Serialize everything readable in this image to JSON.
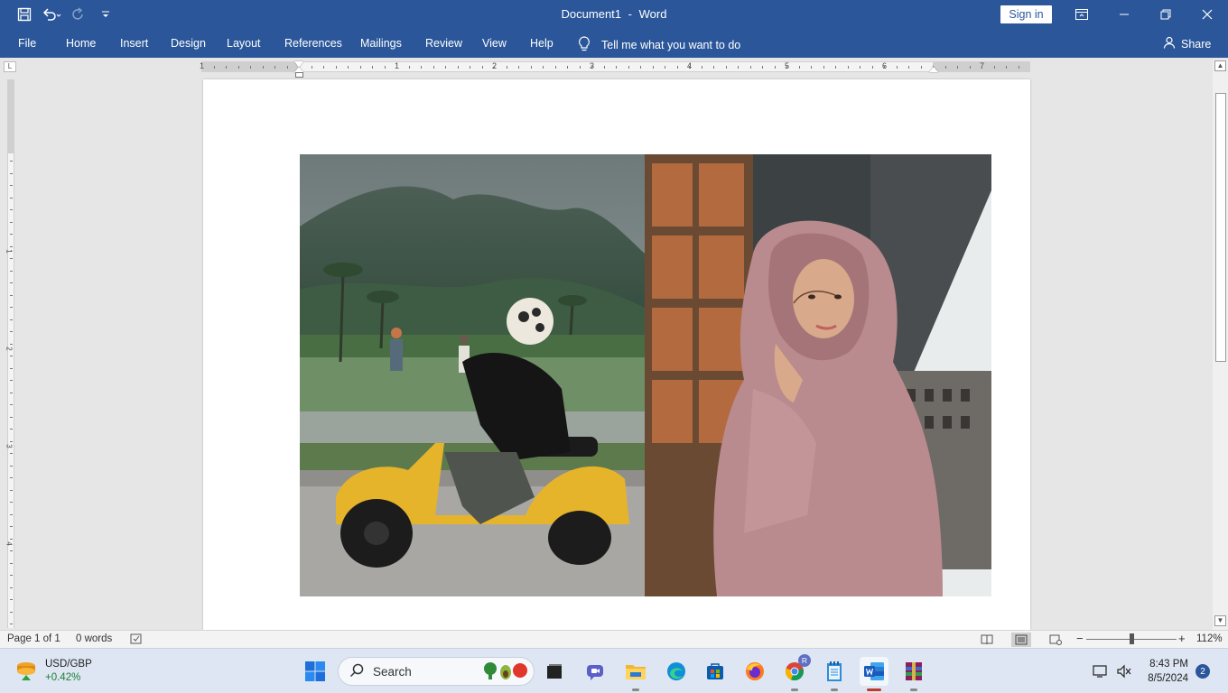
{
  "title_bar": {
    "document_name": "Document1",
    "separator": "-",
    "app_name": "Word",
    "sign_in_label": "Sign in",
    "qat_icons": [
      "save-icon",
      "undo-icon",
      "redo-icon",
      "customize-qat-icon"
    ]
  },
  "ribbon": {
    "tabs": [
      "File",
      "Home",
      "Insert",
      "Design",
      "Layout",
      "References",
      "Mailings",
      "Review",
      "View",
      "Help"
    ],
    "tell_me": "Tell me what you want to do",
    "share_label": "Share"
  },
  "ruler": {
    "horizontal_numbers": [
      "1",
      "1",
      "2",
      "3",
      "4",
      "5",
      "6",
      "7"
    ],
    "vertical_numbers": [
      "1",
      "2",
      "3",
      "4"
    ],
    "tab_selector": "L"
  },
  "document": {
    "images": [
      {
        "name": "scooter-rider-photo",
        "description": "person in helmet riding yellow scooter"
      },
      {
        "name": "hijab-woman-photo",
        "description": "woman in pink hijab"
      }
    ]
  },
  "status_bar": {
    "page_info": "Page 1 of 1",
    "word_count": "0 words",
    "zoom_minus": "−",
    "zoom_plus": "+",
    "zoom_level": "112%"
  },
  "taskbar": {
    "widget_title": "USD/GBP",
    "widget_change": "+0.42%",
    "search_label": "Search",
    "chrome_badge": "R",
    "time": "8:43 PM",
    "date": "8/5/2024",
    "notification_count": "2"
  },
  "colors": {
    "word_blue": "#2b579a",
    "taskbar_bg": "#dde6f2",
    "positive_change": "#1a7f37"
  }
}
